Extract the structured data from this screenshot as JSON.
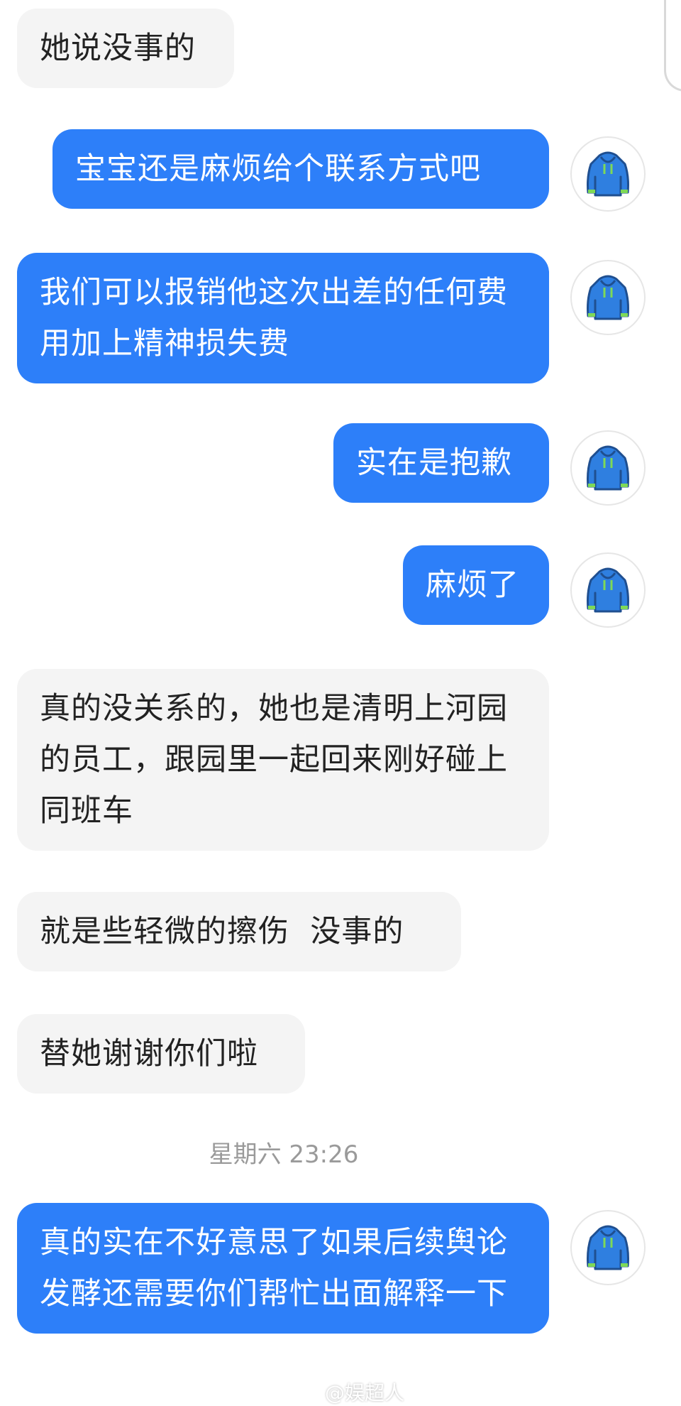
{
  "messages": [
    {
      "text": "她说没事的"
    },
    {
      "text": "宝宝还是麻烦给个联系方式吧"
    },
    {
      "text": "我们可以报销他这次出差的任何费用加上精神损失费"
    },
    {
      "text": "实在是抱歉"
    },
    {
      "text": "麻烦了"
    },
    {
      "text": "真的没关系的，她也是清明上河园的员工，跟园里一起回来刚好碰上同班车"
    },
    {
      "text": "就是些轻微的擦伤  没事的"
    },
    {
      "text": "替她谢谢你们啦"
    },
    {
      "text": "真的实在不好意思了如果后续舆论发酵还需要你们帮忙出面解释一下"
    }
  ],
  "timestamp": "星期六 23:26",
  "watermark": "@娱超人",
  "avatar_icon": "hoodie-icon",
  "colors": {
    "outgoing_bubble": "#2d7ff9",
    "incoming_bubble": "#f4f4f4",
    "avatar_hoodie": "#2f7fe0",
    "avatar_strings": "#7ed957"
  }
}
